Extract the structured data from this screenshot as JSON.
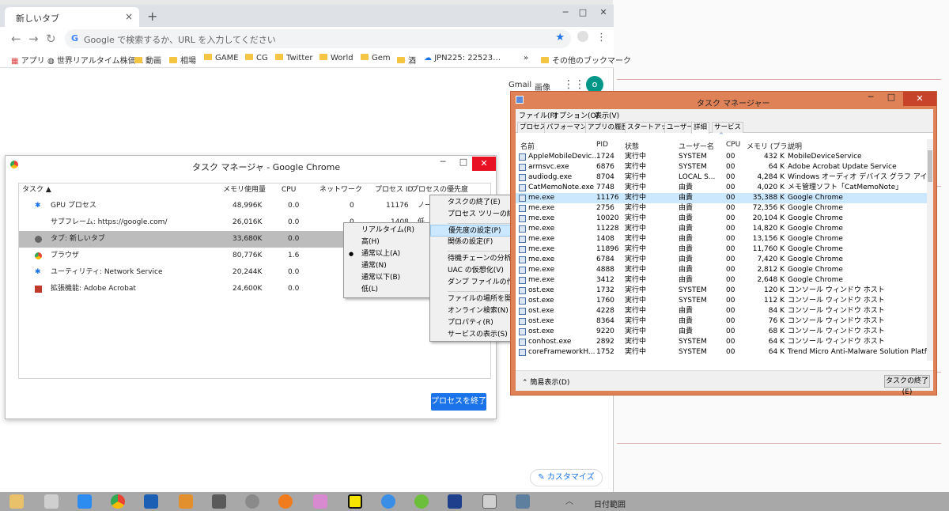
{
  "browser": {
    "tab_title": "新しいタブ",
    "tab_close": "×",
    "new_tab": "+",
    "win_min": "─",
    "win_max": "□",
    "win_close": "✕",
    "omnibox_placeholder": "Google で検索するか、URL を入力してください",
    "bookmarks": [
      "アプリ",
      "世界リアルタイム株価…",
      "動画",
      "相場",
      "GAME",
      "CG",
      "Twitter",
      "World",
      "Gem",
      "酒",
      "JPN225: 22523…"
    ],
    "bookmarks_more": "»",
    "other_bookmarks": "その他のブックマーク",
    "gmail": "Gmail",
    "images": "画像",
    "profile_initial": "o",
    "customize": "カスタマイズ"
  },
  "chrome_task_manager": {
    "title": "タスク マネージャ - Google Chrome",
    "columns": [
      "タスク ▲",
      "メモリ使用量",
      "CPU",
      "ネットワーク",
      "プロセス ID",
      "プロセスの優先度"
    ],
    "rows": [
      {
        "task": "GPU プロセス",
        "memory": "48,996K",
        "cpu": "0.0",
        "network": "0",
        "pid": "11176",
        "priority": "ノーマ"
      },
      {
        "task": "サブフレーム: https://google.com/",
        "memory": "26,016K",
        "cpu": "0.0",
        "network": "0",
        "pid": "1408",
        "priority": "低"
      },
      {
        "task": "タブ: 新しいタブ",
        "memory": "33,680K",
        "cpu": "0.0",
        "network": "",
        "pid": "",
        "priority": ""
      },
      {
        "task": "ブラウザ",
        "memory": "80,776K",
        "cpu": "1.6",
        "network": "",
        "pid": "",
        "priority": ""
      },
      {
        "task": "ユーティリティ: Network Service",
        "memory": "20,244K",
        "cpu": "0.0",
        "network": "",
        "pid": "",
        "priority": ""
      },
      {
        "task": "拡張機能: Adobe Acrobat",
        "memory": "24,600K",
        "cpu": "0.0",
        "network": "",
        "pid": "",
        "priority": ""
      }
    ],
    "end_process": "プロセスを終了"
  },
  "priority_menu": {
    "items": [
      "リアルタイム(R)",
      "高(H)",
      "通常以上(A)",
      "通常(N)",
      "通常以下(B)",
      "低(L)"
    ],
    "checked_mark": "●"
  },
  "context_menu": {
    "group1": [
      "タスクの終了(E)",
      "プロセス ツリーの終了(T)"
    ],
    "group2": [
      "優先度の設定(P)",
      "関係の設定(F)"
    ],
    "group3": [
      "待機チェーンの分析(A)",
      "UAC の仮想化(V)",
      "ダンプ ファイルの作成(C)"
    ],
    "group4": [
      "ファイルの場所を開く(O)",
      "オンライン検索(N)",
      "プロパティ(R)",
      "サービスの表示(S)"
    ],
    "submenu_arrow": "▸"
  },
  "windows_task_manager": {
    "title": "タスク マネージャー",
    "menus": [
      "ファイル(F)",
      "オプション(O)",
      "表示(V)"
    ],
    "tabs": [
      "プロセス",
      "パフォーマンス",
      "アプリの履歴",
      "スタートアップ",
      "ユーザー",
      "詳細",
      "サービス"
    ],
    "active_tab": "詳細",
    "columns": [
      "名前",
      "PID",
      "状態",
      "ユーザー名",
      "CPU",
      "メモリ (プラ...",
      "説明"
    ],
    "rows": [
      {
        "name": "AppleMobileDevic...",
        "pid": "1724",
        "status": "実行中",
        "user": "SYSTEM",
        "cpu": "00",
        "mem": "432 K",
        "desc": "MobileDeviceService"
      },
      {
        "name": "armsvc.exe",
        "pid": "6876",
        "status": "実行中",
        "user": "SYSTEM",
        "cpu": "00",
        "mem": "64 K",
        "desc": "Adobe Acrobat Update Service"
      },
      {
        "name": "audiodg.exe",
        "pid": "8704",
        "status": "実行中",
        "user": "LOCAL S...",
        "cpu": "00",
        "mem": "4,284 K",
        "desc": "Windows オーディオ デバイス グラフ アイソレーション"
      },
      {
        "name": "CatMemoNote.exe",
        "pid": "7748",
        "status": "実行中",
        "user": "由貴",
        "cpu": "00",
        "mem": "4,020 K",
        "desc": "メモ管理ソフト「CatMemoNote」"
      },
      {
        "name": "me.exe",
        "pid": "11176",
        "status": "実行中",
        "user": "由貴",
        "cpu": "00",
        "mem": "35,388 K",
        "desc": "Google Chrome"
      },
      {
        "name": "me.exe",
        "pid": "2756",
        "status": "実行中",
        "user": "由貴",
        "cpu": "00",
        "mem": "72,356 K",
        "desc": "Google Chrome"
      },
      {
        "name": "me.exe",
        "pid": "10020",
        "status": "実行中",
        "user": "由貴",
        "cpu": "00",
        "mem": "20,104 K",
        "desc": "Google Chrome"
      },
      {
        "name": "me.exe",
        "pid": "11228",
        "status": "実行中",
        "user": "由貴",
        "cpu": "00",
        "mem": "14,820 K",
        "desc": "Google Chrome"
      },
      {
        "name": "me.exe",
        "pid": "1408",
        "status": "実行中",
        "user": "由貴",
        "cpu": "00",
        "mem": "13,156 K",
        "desc": "Google Chrome"
      },
      {
        "name": "me.exe",
        "pid": "11896",
        "status": "実行中",
        "user": "由貴",
        "cpu": "00",
        "mem": "11,760 K",
        "desc": "Google Chrome"
      },
      {
        "name": "me.exe",
        "pid": "6784",
        "status": "実行中",
        "user": "由貴",
        "cpu": "00",
        "mem": "7,420 K",
        "desc": "Google Chrome"
      },
      {
        "name": "me.exe",
        "pid": "4888",
        "status": "実行中",
        "user": "由貴",
        "cpu": "00",
        "mem": "2,812 K",
        "desc": "Google Chrome"
      },
      {
        "name": "me.exe",
        "pid": "3412",
        "status": "実行中",
        "user": "由貴",
        "cpu": "00",
        "mem": "2,648 K",
        "desc": "Google Chrome"
      },
      {
        "name": "ost.exe",
        "pid": "1732",
        "status": "実行中",
        "user": "SYSTEM",
        "cpu": "00",
        "mem": "120 K",
        "desc": "コンソール ウィンドウ ホスト"
      },
      {
        "name": "ost.exe",
        "pid": "1760",
        "status": "実行中",
        "user": "SYSTEM",
        "cpu": "00",
        "mem": "112 K",
        "desc": "コンソール ウィンドウ ホスト"
      },
      {
        "name": "ost.exe",
        "pid": "4228",
        "status": "実行中",
        "user": "由貴",
        "cpu": "00",
        "mem": "84 K",
        "desc": "コンソール ウィンドウ ホスト"
      },
      {
        "name": "ost.exe",
        "pid": "8364",
        "status": "実行中",
        "user": "由貴",
        "cpu": "00",
        "mem": "76 K",
        "desc": "コンソール ウィンドウ ホスト"
      },
      {
        "name": "ost.exe",
        "pid": "9220",
        "status": "実行中",
        "user": "由貴",
        "cpu": "00",
        "mem": "68 K",
        "desc": "コンソール ウィンドウ ホスト"
      },
      {
        "name": "conhost.exe",
        "pid": "2892",
        "status": "実行中",
        "user": "SYSTEM",
        "cpu": "00",
        "mem": "64 K",
        "desc": "コンソール ウィンドウ ホスト"
      },
      {
        "name": "coreFrameworkH...",
        "pid": "1752",
        "status": "実行中",
        "user": "SYSTEM",
        "cpu": "00",
        "mem": "64 K",
        "desc": "Trend Micro Anti-Malware Solution Platfo..."
      }
    ],
    "brief": "簡易表示(D)",
    "end_task": "タスクの終了(E)"
  },
  "taskbar": {
    "tray_text": "日付範囲"
  },
  "colors": {
    "chrome_blue": "#1a73e8",
    "wtm_frame": "#e08258",
    "selection": "#cce8ff"
  }
}
